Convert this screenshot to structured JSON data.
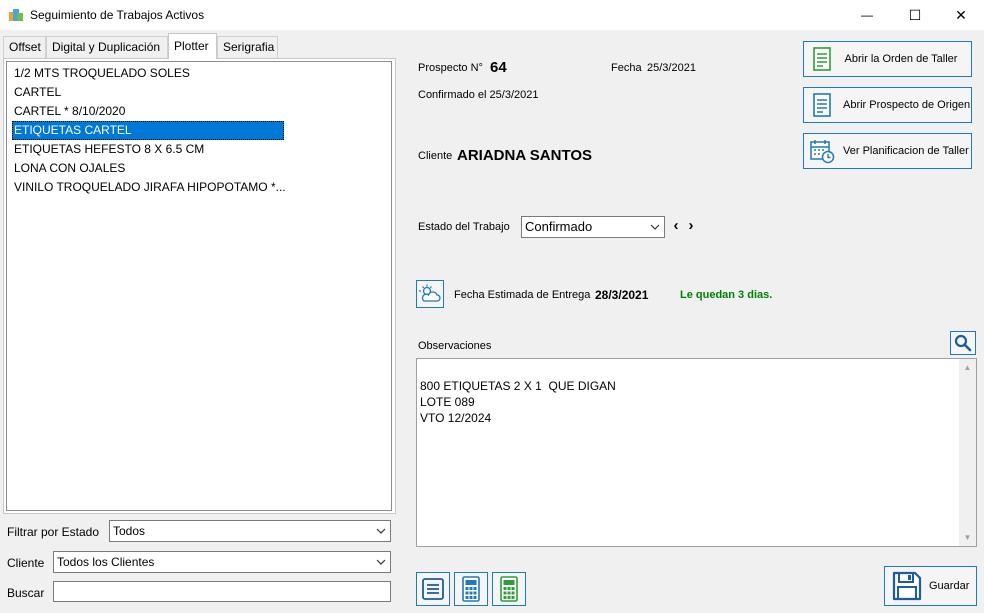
{
  "window": {
    "title": "Seguimiento de Trabajos Activos",
    "minimize": "—",
    "maximize": "☐",
    "close": "✕"
  },
  "tabs": [
    {
      "label": "Offset"
    },
    {
      "label": "Digital y Duplicación"
    },
    {
      "label": "Plotter"
    },
    {
      "label": "Serigrafia"
    }
  ],
  "jobs": [
    "1/2 MTS TROQUELADO SOLES",
    "CARTEL",
    "CARTEL * 8/10/2020",
    "ETIQUETAS CARTEL",
    "ETIQUETAS HEFESTO 8 X 6.5 CM",
    "LONA CON OJALES",
    "VINILO TROQUELADO JIRAFA HIPOPOTAMO *..."
  ],
  "selected_job_index": 3,
  "filters": {
    "estado_label": "Filtrar por Estado",
    "estado_value": "Todos",
    "cliente_label": "Cliente",
    "cliente_value": "Todos los Clientes",
    "buscar_label": "Buscar",
    "buscar_value": ""
  },
  "detail": {
    "prospecto_label": "Prospecto N°",
    "prospecto_value": "64",
    "fecha_label": "Fecha",
    "fecha_value": "25/3/2021",
    "confirmado_text": "Confirmado el 25/3/2021",
    "cliente_label": "Cliente",
    "cliente_value": "ARIADNA SANTOS",
    "estado_label": "Estado del Trabajo",
    "estado_value": "Confirmado",
    "prev_arrow": "‹",
    "next_arrow": "›",
    "entrega_label": "Fecha Estimada de Entrega",
    "entrega_value": "28/3/2021",
    "quedan_text": "Le quedan 3 dias.",
    "observaciones_label": "Observaciones",
    "observaciones_text": "800 ETIQUETAS 2 X 1  QUE DIGAN\nLOTE 089\nVTO 12/2024"
  },
  "actions": {
    "abrir_orden": "Abrir la Orden de Taller",
    "abrir_prospecto": "Abrir Prospecto de Origen",
    "ver_planificacion": "Ver Planificacion de Taller",
    "guardar": "Guardar"
  },
  "colors": {
    "accent": "#1e7ab8",
    "selection": "#0078d7",
    "green_text": "#008000",
    "green_icon": "#2e9e3a"
  }
}
